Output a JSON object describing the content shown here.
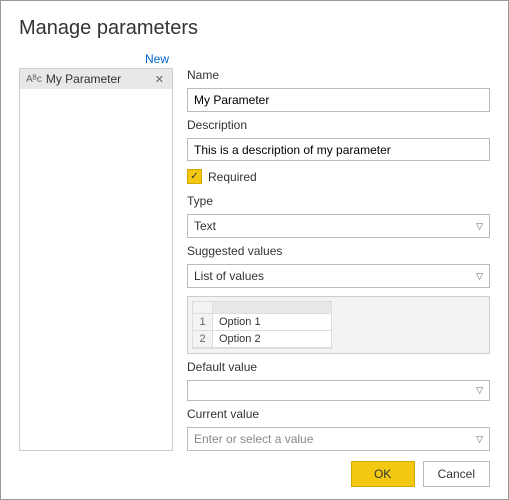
{
  "title": "Manage parameters",
  "sidebar": {
    "new_label": "New",
    "items": [
      {
        "icon": "Aᴮc",
        "label": "My Parameter"
      }
    ]
  },
  "form": {
    "name_label": "Name",
    "name_value": "My Parameter",
    "description_label": "Description",
    "description_value": "This is a description of my parameter",
    "required_label": "Required",
    "required_checked": true,
    "type_label": "Type",
    "type_value": "Text",
    "suggested_label": "Suggested values",
    "suggested_value": "List of values",
    "list_values": [
      "Option 1",
      "Option 2"
    ],
    "default_label": "Default value",
    "default_value": "",
    "current_label": "Current value",
    "current_placeholder": "Enter or select a value"
  },
  "footer": {
    "ok": "OK",
    "cancel": "Cancel"
  }
}
